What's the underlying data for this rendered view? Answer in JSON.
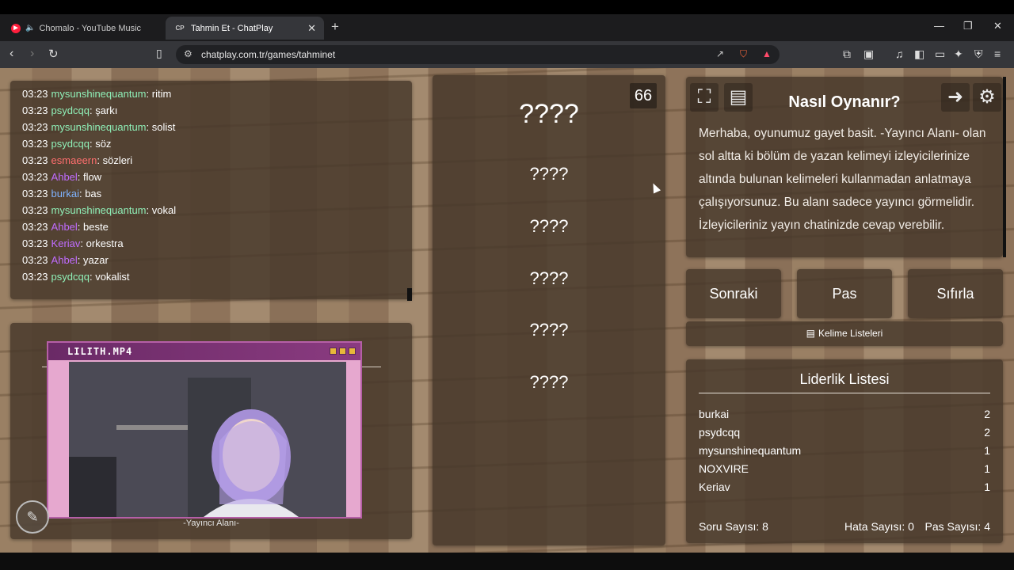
{
  "browser": {
    "tabs": [
      {
        "label": "Chomalo - YouTube Music",
        "icon": "youtube-music-icon"
      },
      {
        "label": "Tahmin Et - ChatPlay",
        "icon": "chatplay-icon",
        "icon_text": "CP"
      }
    ],
    "url": "chatplay.com.tr/games/tahminet"
  },
  "chat": {
    "messages": [
      {
        "time": "03:23",
        "user": "mysunshinequantum",
        "color": "#8ff0b8",
        "text": ": ritim"
      },
      {
        "time": "03:23",
        "user": "psydcqq",
        "color": "#8ff0b8",
        "text": ": şarkı"
      },
      {
        "time": "03:23",
        "user": "mysunshinequantum",
        "color": "#8ff0b8",
        "text": ": solist"
      },
      {
        "time": "03:23",
        "user": "psydcqq",
        "color": "#8ff0b8",
        "text": ": söz"
      },
      {
        "time": "03:23",
        "user": "esmaeern",
        "color": "#ff6e6e",
        "text": ": sözleri"
      },
      {
        "time": "03:23",
        "user": "Ahbel",
        "color": "#c06cff",
        "text": ": flow"
      },
      {
        "time": "03:23",
        "user": "burkai",
        "color": "#7fb3ff",
        "text": ": bas"
      },
      {
        "time": "03:23",
        "user": "mysunshinequantum",
        "color": "#8ff0b8",
        "text": ": vokal"
      },
      {
        "time": "03:23",
        "user": "Ahbel",
        "color": "#c06cff",
        "text": ": beste"
      },
      {
        "time": "03:23",
        "user": "Keriav",
        "color": "#c06cff",
        "text": ": orkestra"
      },
      {
        "time": "03:23",
        "user": "Ahbel",
        "color": "#c06cff",
        "text": ": yazar"
      },
      {
        "time": "03:23",
        "user": "psydcqq",
        "color": "#8ff0b8",
        "text": ": vokalist"
      }
    ]
  },
  "stream": {
    "window_title": "LILITH.MP4",
    "caption": "-Yayıncı Alanı-"
  },
  "words": {
    "counter": "66",
    "main": "????",
    "hints": [
      "????",
      "????",
      "????",
      "????",
      "????"
    ]
  },
  "howto": {
    "title": "Nasıl Oynanır?",
    "text": "Merhaba, oyunumuz gayet basit. -Yayıncı Alanı- olan sol altta ki bölüm de yazan kelimeyi izleyicilerinize altında bulunan kelimeleri kullanmadan anlatmaya çalışıyorsunuz. Bu alanı sadece yayıncı görmelidir. İzleyicileriniz yayın chatinizde cevap verebilir."
  },
  "controls": {
    "next": "Sonraki",
    "pass": "Pas",
    "reset": "Sıfırla",
    "word_lists": "Kelime Listeleri"
  },
  "leaderboard": {
    "title": "Liderlik Listesi",
    "rows": [
      {
        "name": "burkai",
        "score": "2"
      },
      {
        "name": "psydcqq",
        "score": "2"
      },
      {
        "name": "mysunshinequantum",
        "score": "1"
      },
      {
        "name": "NOXVIRE",
        "score": "1"
      },
      {
        "name": "Keriav",
        "score": "1"
      }
    ],
    "questions": "Soru Sayısı: 8",
    "errors": "Hata Sayısı: 0",
    "passes": "Pas Sayısı: 4"
  }
}
